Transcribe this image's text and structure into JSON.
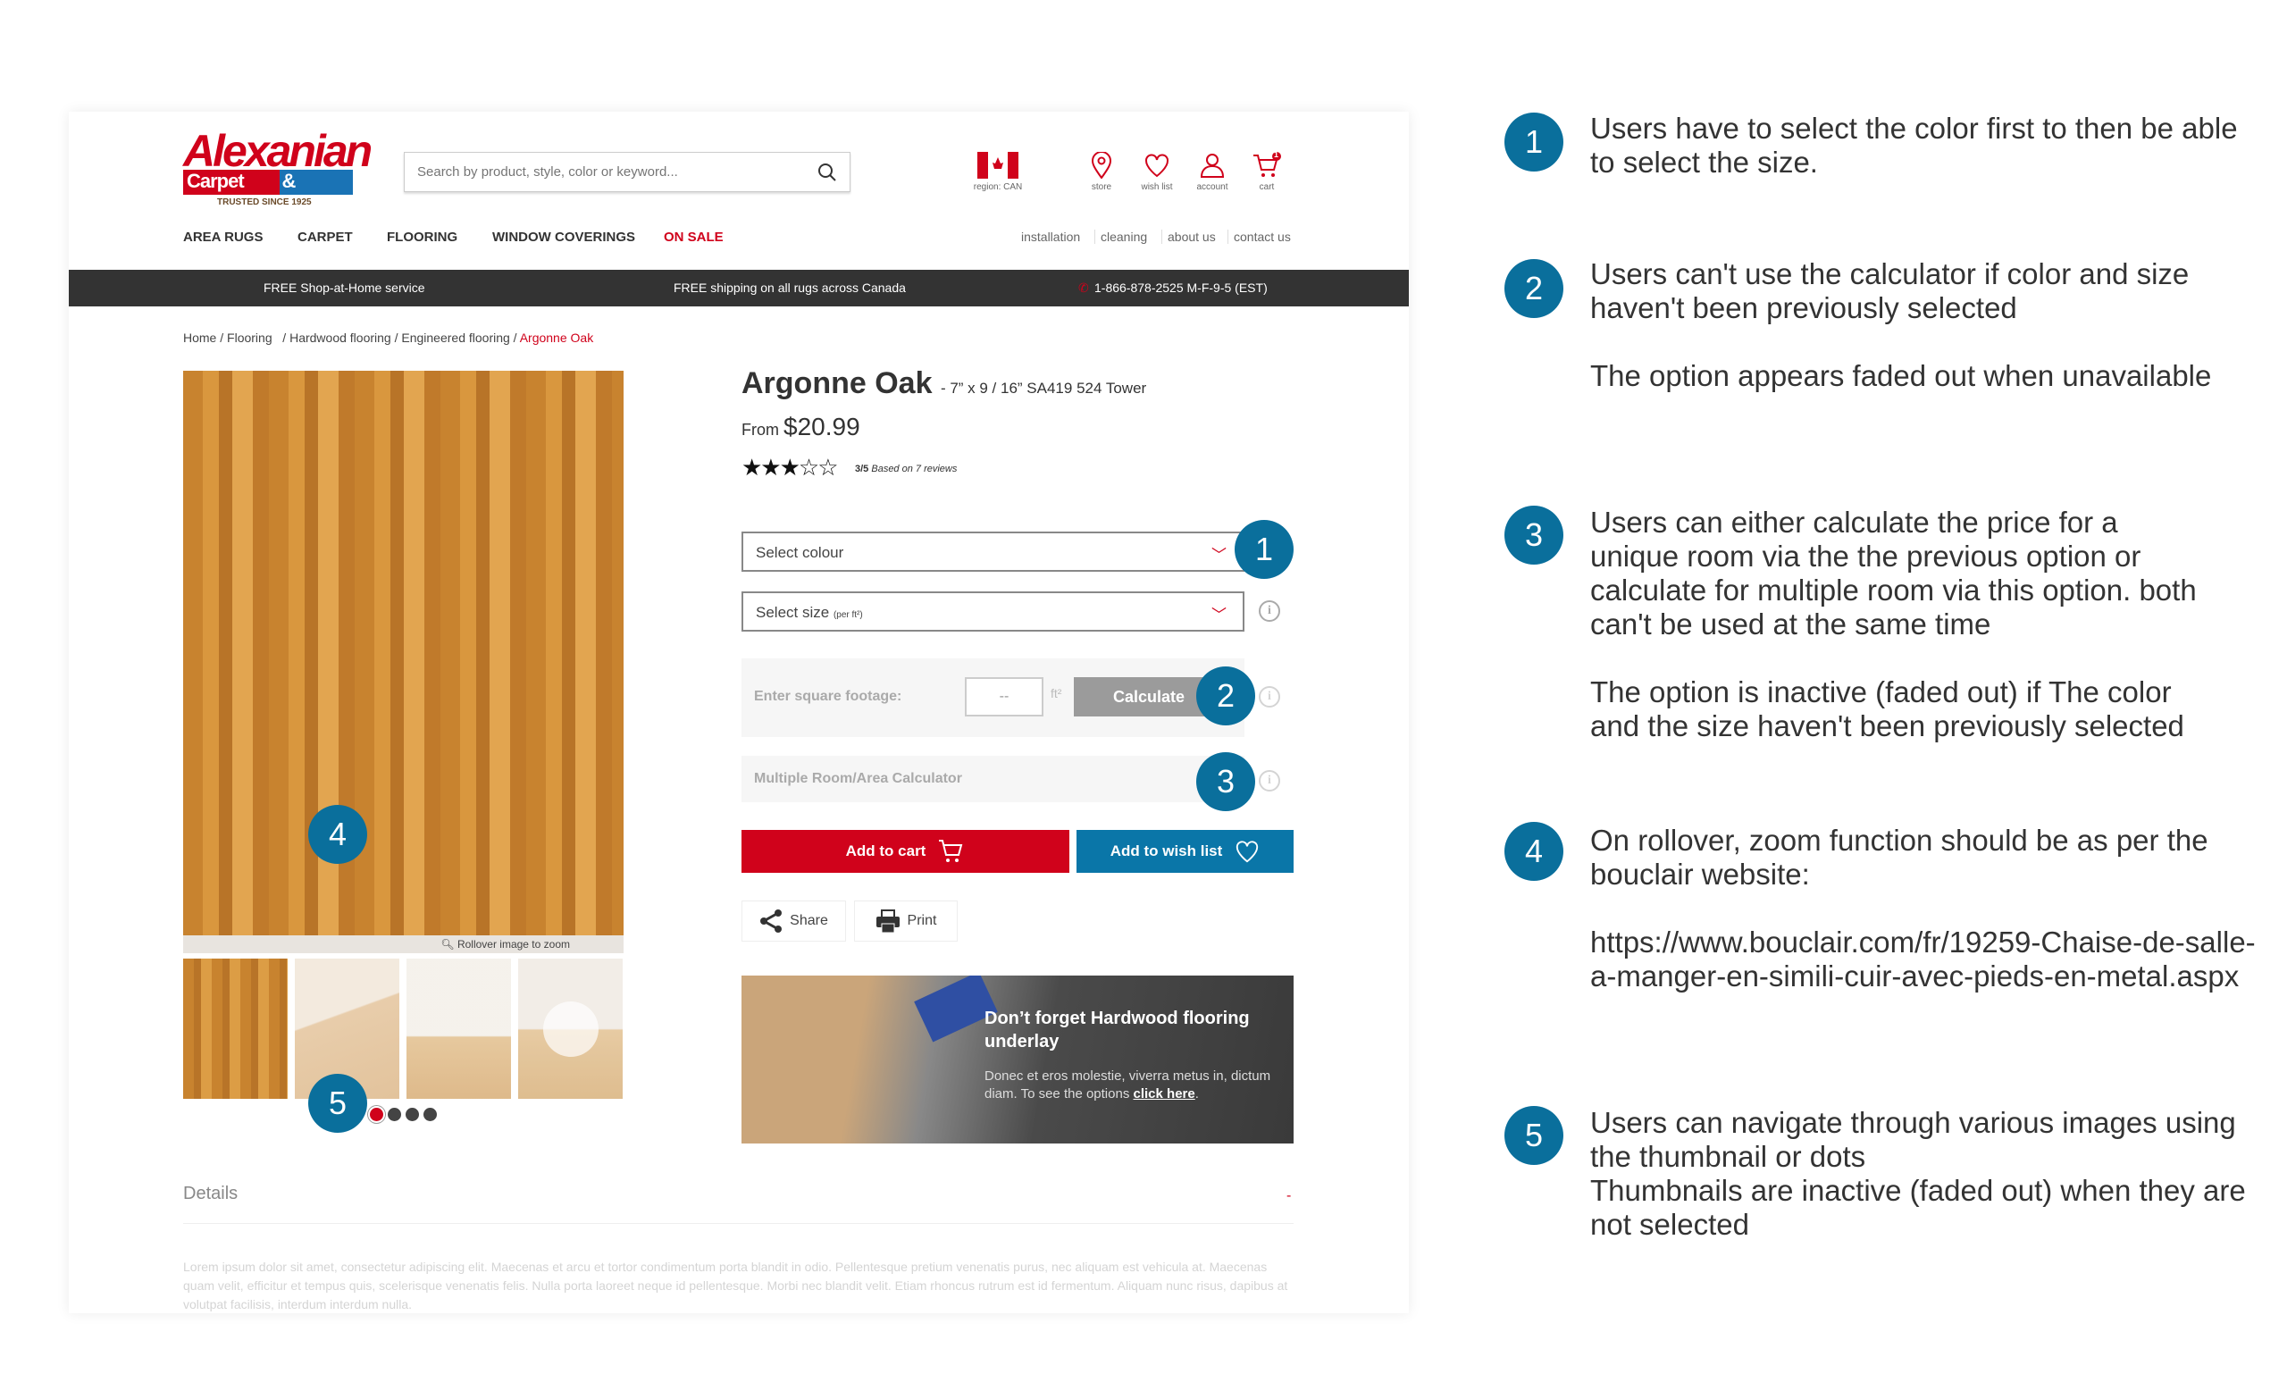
{
  "header": {
    "logo_main": "Alexanian",
    "logo_sub1": "Carpet",
    "logo_sub2": "& Flooring",
    "logo_tagline": "TRUSTED SINCE 1925",
    "search_placeholder": "Search by product, style, color or keyword...",
    "region_label": "region: CAN",
    "store_label": "store",
    "wishlist_label": "wish list",
    "account_label": "account",
    "cart_label": "cart",
    "cart_count": "1"
  },
  "nav": {
    "items": [
      "AREA RUGS",
      "CARPET",
      "FLOORING",
      "WINDOW COVERINGS",
      "ON SALE"
    ],
    "secondary": [
      "installation",
      "cleaning",
      "about us",
      "contact us"
    ]
  },
  "promo_bar": {
    "left": "FREE Shop-at-Home service",
    "center": "FREE shipping on all rugs across Canada",
    "phone": "1-866-878-2525 M-F-9-5 (EST)"
  },
  "breadcrumb": [
    "Home",
    "Flooring",
    "Hardwood flooring",
    "Engineered flooring",
    "Argonne Oak"
  ],
  "gallery": {
    "rollover_text": "Rollover image to zoom",
    "dots_count": 4,
    "active_dot": 1
  },
  "product": {
    "name": "Argonne Oak",
    "spec": "- 7” x 9 / 16” SA419 524 Tower",
    "price_prefix": "From",
    "price": "$20.99",
    "rating": 3,
    "rating_max": 5,
    "rating_text": "3/5",
    "reviews_text": "Based on 7 reviews",
    "colour_placeholder": "Select colour",
    "size_placeholder": "Select size",
    "size_unit": "(per ft²)",
    "sqft_label": "Enter square footage:",
    "sqft_value": "--",
    "sqft_unit": "ft²",
    "calculate_label": "Calculate",
    "multi_room_label": "Multiple Room/Area Calculator",
    "add_to_cart": "Add to cart",
    "add_to_wishlist": "Add to wish list",
    "share": "Share",
    "print": "Print"
  },
  "banner": {
    "title": "Don’t forget Hardwood flooring underlay",
    "body": "Donec et eros molestie, viverra metus in, dictum diam. To see the options ",
    "link": "click here",
    "end": "."
  },
  "details": {
    "title": "Details",
    "toggle": "-",
    "body": "Lorem ipsum dolor sit amet, consectetur adipiscing elit. Maecenas et arcu et tortor condimentum porta blandit in odio. Pellentesque pretium venenatis purus, nec aliquam est vehicula at. Maecenas quam velit, efficitur et tempus quis, scelerisque venenatis felis. Nulla porta laoreet neque id pellentesque. Morbi nec blandit velit. Etiam rhoncus rutrum est id fermentum. Aliquam nunc risus, dapibus at volutpat facilisis, interdum interdum nulla."
  },
  "markers": [
    "1",
    "2",
    "3",
    "4",
    "5"
  ],
  "annotations": [
    {
      "n": "1",
      "paras": [
        "Users have to select the color first to then be able to select the size."
      ]
    },
    {
      "n": "2",
      "paras": [
        "Users can't use the calculator if color and size haven't been previously selected",
        "The option appears faded out when unavailable"
      ]
    },
    {
      "n": "3",
      "paras": [
        "Users can either calculate the price for a unique room via the the previous option or calculate for multiple room via this option. both can't be used at the same time",
        "The option is inactive (faded out) if The color and the size haven't been previously selected"
      ]
    },
    {
      "n": "4",
      "paras": [
        "On rollover, zoom function should be as per the bouclair website:",
        "https://www.bouclair.com/fr/19259-Chaise-de-salle-a-manger-en-simili-cuir-avec-pieds-en-metal.aspx"
      ]
    },
    {
      "n": "5",
      "paras": [
        "Users can navigate through various images using the thumbnail or dots",
        "Thumbnails are inactive (faded out) when they are not selected"
      ]
    }
  ],
  "colors": {
    "brand_red": "#d0021b",
    "brand_blue": "#0a6f9c",
    "bar": "#333333"
  }
}
